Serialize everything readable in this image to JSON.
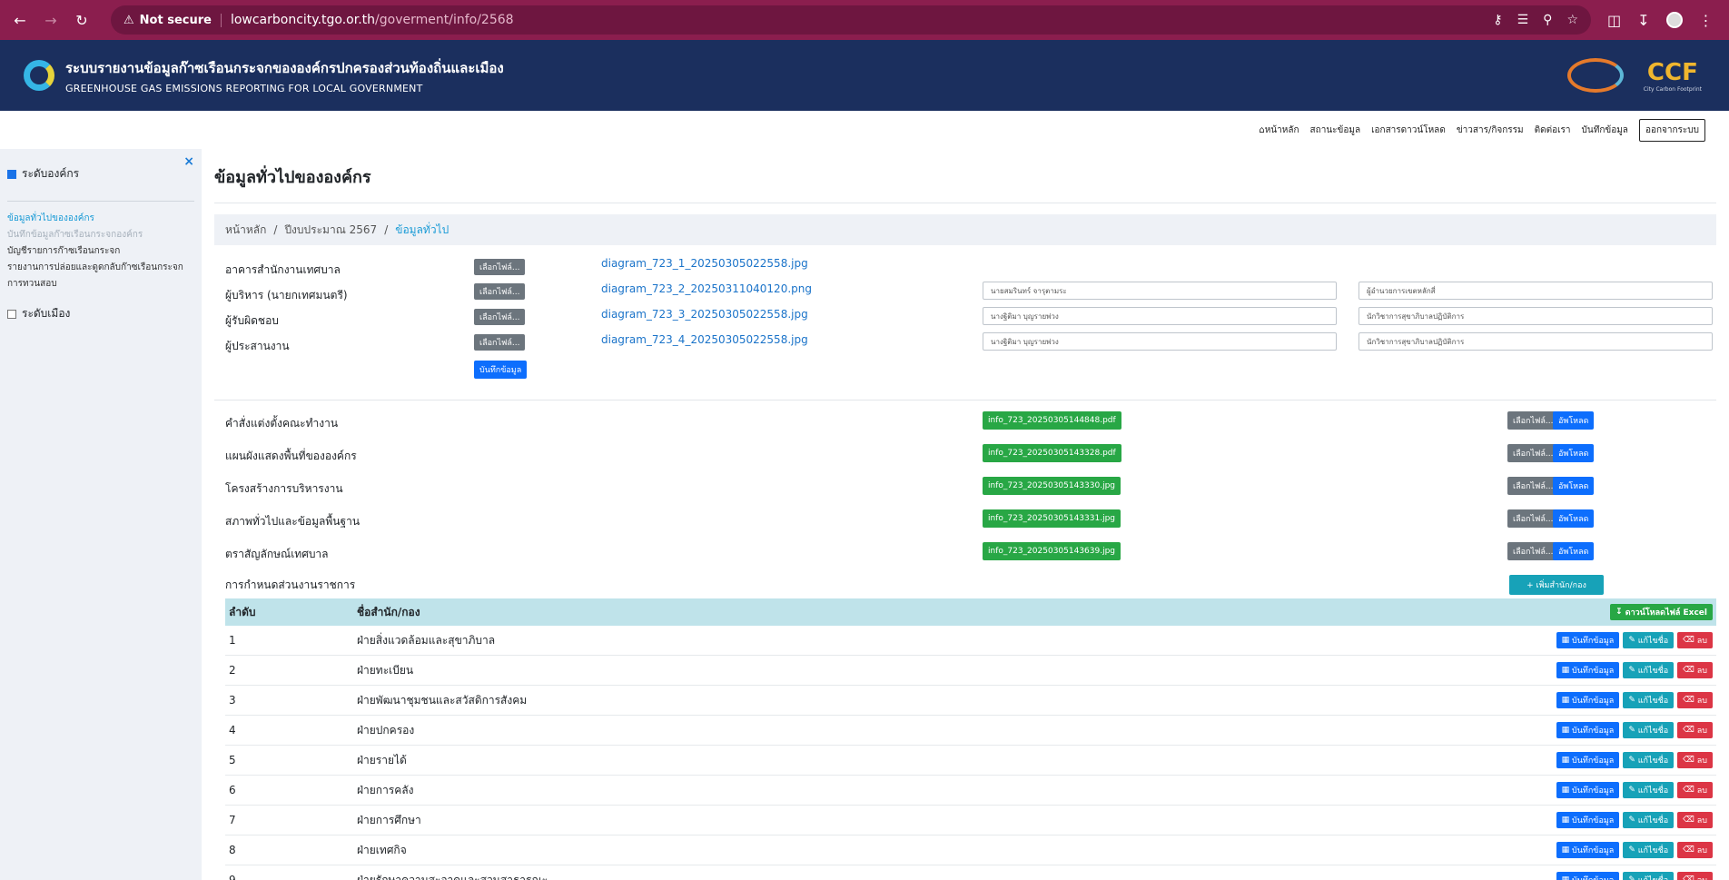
{
  "browser": {
    "not_secure": "Not secure",
    "url_host": "lowcarboncity.tgo.or.th",
    "url_path": "/goverment/info/2568"
  },
  "header": {
    "title_th": "ระบบรายงานข้อมูลก๊าซเรือนกระจกขององค์กรปกครองส่วนท้องถิ่นและเมือง",
    "title_en": "GREENHOUSE GAS EMISSIONS REPORTING FOR LOCAL GOVERNMENT",
    "partner_logo_text": "CCF",
    "partner_logo_sub": "City Carbon Footprint"
  },
  "topnav": {
    "items": [
      "หน้าหลัก",
      "สถานะข้อมูล",
      "เอกสารดาวน์โหลด",
      "ข่าวสาร/กิจกรรม",
      "ติดต่อเรา",
      "บันทึกข้อมูล"
    ],
    "logout": "ออกจากระบบ"
  },
  "sidebar": {
    "close": "×",
    "org_level": "ระดับองค์กร",
    "links": [
      "ข้อมูลทั่วไปขององค์กร",
      "บันทึกข้อมูลก๊าซเรือนกระจกองค์กร",
      "บัญชีรายการก๊าซเรือนกระจก",
      "รายงานการปล่อยและดูดกลับก๊าซเรือนกระจก",
      "การทวนสอบ"
    ],
    "city_level": "ระดับเมือง"
  },
  "main": {
    "title": "ข้อมูลทั่วไปขององค์กร",
    "breadcrumb": [
      "หน้าหลัก",
      "ปีงบประมาณ 2567",
      "ข้อมูลทั่วไป"
    ],
    "choose_file": "เลือกไฟล์...",
    "save_btn": "บันทึกข้อมูล",
    "people": [
      {
        "label": "อาคารสำนักงานเทศบาล",
        "file": "diagram_723_1_20250305022558.jpg",
        "name": "",
        "position": ""
      },
      {
        "label": "ผู้บริหาร (นายกเทศมนตรี)",
        "file": "diagram_723_2_20250311040120.png",
        "name": "นายสมรินทร์ จารุตามระ",
        "position": "ผู้อำนวยการเขตหลักสี่"
      },
      {
        "label": "ผู้รับผิดชอบ",
        "file": "diagram_723_3_20250305022558.jpg",
        "name": "นางฐิติมา บุญรายพ่วง",
        "position": "นักวิชาการสุขาภิบาลปฏิบัติการ"
      },
      {
        "label": "ผู้ประสานงาน",
        "file": "diagram_723_4_20250305022558.jpg",
        "name": "นางฐิติมา บุญรายพ่วง",
        "position": "นักวิชาการสุขาภิบาลปฏิบัติการ"
      }
    ],
    "upload_btn": "อัพโหลด",
    "docs": [
      {
        "label": "คำสั่งแต่งตั้งคณะทำงาน",
        "file": "info_723_20250305144848.pdf"
      },
      {
        "label": "แผนผังแสดงพื้นที่ขององค์กร",
        "file": "info_723_20250305143328.pdf"
      },
      {
        "label": "โครงสร้างการบริหารงาน",
        "file": "info_723_20250305143330.jpg"
      },
      {
        "label": "สภาพทั่วไปและข้อมูลพื้นฐาน",
        "file": "info_723_20250305143331.jpg"
      },
      {
        "label": "ตราสัญลักษณ์เทศบาล",
        "file": "info_723_20250305143639.jpg"
      }
    ],
    "units_label": "การกำหนดส่วนงานราชการ",
    "add_unit_btn": "+ เพิ่มสำนัก/กอง",
    "table": {
      "col_no": "ลำดับ",
      "col_name": "ชื่อสำนัก/กอง",
      "excel_btn": "ดาวน์โหลดไฟล์ Excel",
      "act_save": "บันทึกข้อมูล",
      "act_edit": "แก้ไขชื่อ",
      "act_delete": "ลบ",
      "rows": [
        {
          "no": "1",
          "name": "ฝ่ายสิ่งแวดล้อมและสุขาภิบาล"
        },
        {
          "no": "2",
          "name": "ฝ่ายทะเบียน"
        },
        {
          "no": "3",
          "name": "ฝ่ายพัฒนาชุมชนและสวัสดิการสังคม"
        },
        {
          "no": "4",
          "name": "ฝ่ายปกครอง"
        },
        {
          "no": "5",
          "name": "ฝ่ายรายได้"
        },
        {
          "no": "6",
          "name": "ฝ่ายการคลัง"
        },
        {
          "no": "7",
          "name": "ฝ่ายการศึกษา"
        },
        {
          "no": "8",
          "name": "ฝ่ายเทศกิจ"
        },
        {
          "no": "9",
          "name": "ฝ่ายรักษาความสะอาดและสวนสาธารณะ"
        }
      ]
    }
  }
}
